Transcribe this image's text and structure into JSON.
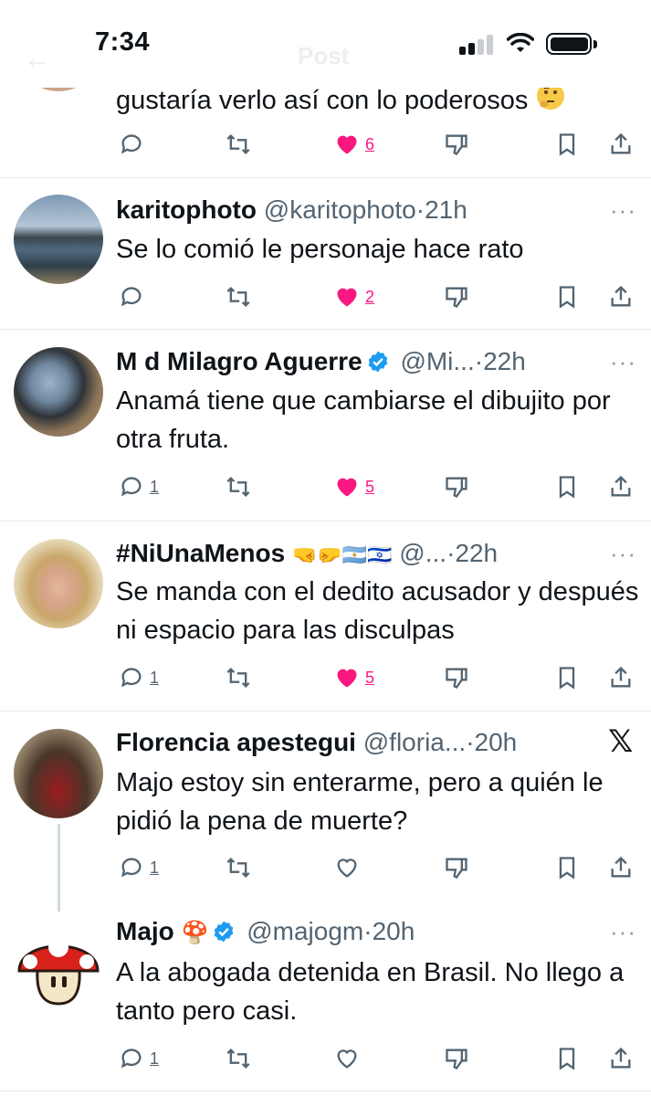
{
  "status_bar": {
    "time": "7:34"
  },
  "header_ghost": {
    "back": "←",
    "title": "Post"
  },
  "colors": {
    "like_pink": "#f91880",
    "verified_blue": "#1d9bf0",
    "text_gray": "#536471"
  },
  "tweets": [
    {
      "text_line": "gustaría verlo así con lo poderosos",
      "emoji": "thinking-face",
      "reply_count": "",
      "like_count": "6"
    },
    {
      "name": "karitophoto",
      "handle": "@karitophoto",
      "time": "21h",
      "text": "Se lo comió le personaje hace rato",
      "reply_count": "",
      "like_count": "2"
    },
    {
      "name": "M d Milagro Aguerre",
      "handle": "@Mi...",
      "time": "22h",
      "verified": true,
      "text": "Anamá tiene que cambiarse el dibujito por otra fruta.",
      "reply_count": "1",
      "like_count": "5"
    },
    {
      "name": "#NiUnaMenos",
      "name_emojis": "🤜🤛🇦🇷🇮🇱",
      "handle": "@...",
      "time": "22h",
      "text": "Se manda con el dedito acusador y después ni espacio para las disculpas",
      "reply_count": "1",
      "like_count": "5"
    },
    {
      "name": "Florencia apestegui",
      "handle": "@floria...",
      "time": "20h",
      "text": "Majo estoy sin enterarme, pero a quién le pidió la pena de muerte?",
      "reply_count": "1",
      "like_count": "",
      "badge_right": "𝕏"
    },
    {
      "name": "Majo",
      "name_emoji": "🍄",
      "handle": "@majogm",
      "time": "20h",
      "verified": true,
      "text": "A la abogada detenida en Brasil. No llego a tanto pero casi.",
      "reply_count": "1",
      "like_count": ""
    }
  ],
  "separator": "·",
  "more_label": "···"
}
